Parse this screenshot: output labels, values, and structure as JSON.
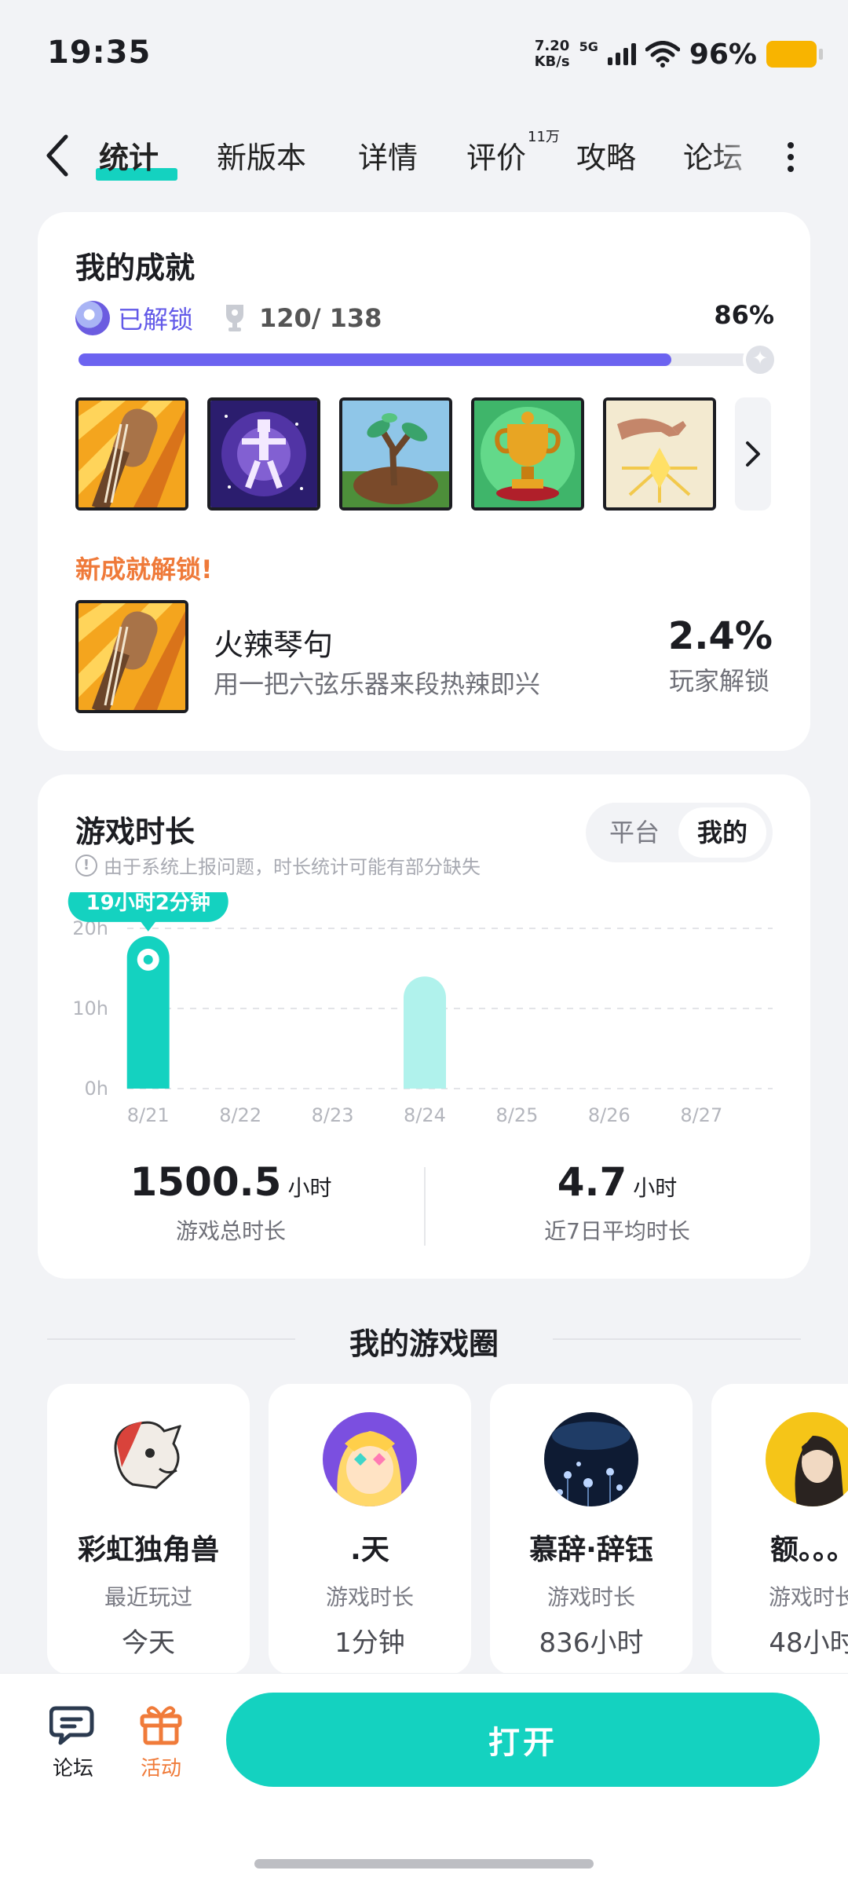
{
  "status": {
    "time": "19:35",
    "netspeed_value": "7.20",
    "netspeed_unit": "KB/s",
    "network": "5G",
    "battery": "96%"
  },
  "tabs": [
    {
      "label": "统计",
      "active": true
    },
    {
      "label": "新版本"
    },
    {
      "label": "详情"
    },
    {
      "label": "评价",
      "badge": "11万"
    },
    {
      "label": "攻略"
    },
    {
      "label": "论坛"
    }
  ],
  "achievements": {
    "title": "我的成就",
    "unlocked_label": "已解锁",
    "count": "120/ 138",
    "percent_text": "86%",
    "progress": 0.86,
    "new_label": "新成就解锁!",
    "new": {
      "name": "火辣琴句",
      "desc": "用一把六弦乐器来段热辣即兴",
      "rate": "2.4%",
      "rate_label": "玩家解锁"
    },
    "thumbs": [
      "guitar-achievement-icon",
      "star-figure-achievement-icon",
      "sapling-achievement-icon",
      "trophy-achievement-icon",
      "golden-hand-achievement-icon"
    ]
  },
  "playtime": {
    "title": "游戏时长",
    "notice": "由于系统上报问题，时长统计可能有部分缺失",
    "toggle": {
      "platform": "平台",
      "mine": "我的"
    },
    "tooltip": "19小时2分钟",
    "total_value": "1500.5",
    "total_unit": "小时",
    "total_label": "游戏总时长",
    "avg_value": "4.7",
    "avg_unit": "小时",
    "avg_label": "近7日平均时长"
  },
  "chart_data": {
    "type": "bar",
    "categories": [
      "8/21",
      "8/22",
      "8/23",
      "8/24",
      "8/25",
      "8/26",
      "8/27"
    ],
    "values": [
      19.03,
      0,
      0,
      14,
      0,
      0,
      0
    ],
    "yticks": [
      "0h",
      "10h",
      "20h"
    ],
    "ylim": [
      0,
      20
    ],
    "highlight_index": 0,
    "colors": {
      "highlight": "#14d2c0",
      "normal": "#b0f2ec"
    }
  },
  "circle": {
    "title": "我的游戏圈",
    "friends": [
      {
        "name": "彩虹独角兽",
        "label": "最近玩过",
        "value": "今天"
      },
      {
        "name": ".天",
        "label": "游戏时长",
        "value": "1分钟"
      },
      {
        "name": "慕辞·辞钰",
        "label": "游戏时长",
        "value": "836小时"
      },
      {
        "name": "额。。。",
        "label": "游戏时长",
        "value": "48小时"
      }
    ]
  },
  "bottom": {
    "forum": "论坛",
    "activity": "活动",
    "open": "打开"
  },
  "colors": {
    "accent": "#14d2c0",
    "purple": "#6c63f0",
    "orange": "#ef7a3a"
  }
}
